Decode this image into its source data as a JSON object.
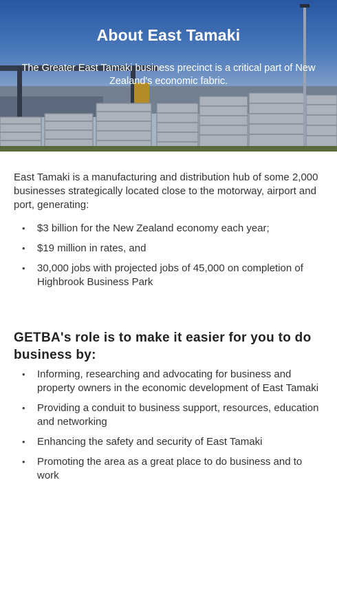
{
  "hero": {
    "title": "About East Tamaki",
    "subtitle": "The Greater East Tamaki business precinct is a critical part of New Zealand's economic fabric."
  },
  "intro": {
    "text": "East Tamaki is a manufacturing and distribution hub of some 2,000 businesses strategically located close to the motorway, airport and port, generating:"
  },
  "stats": {
    "bullet": "•",
    "items": [
      "$3 billion for the New Zealand economy each year;",
      "$19 million in rates, and",
      "30,000 jobs with projected jobs of 45,000 on completion of Highbrook Business Park"
    ]
  },
  "role": {
    "heading": "GETBA's role is to make it easier for you to do business by:",
    "items": [
      "Informing, researching and advocating for business and property owners in the economic development of East Tamaki",
      "Providing a conduit to business support, resources, education and networking",
      "Enhancing the safety and security of East Tamaki",
      "Promoting the area as a great place to do business and to work"
    ]
  }
}
